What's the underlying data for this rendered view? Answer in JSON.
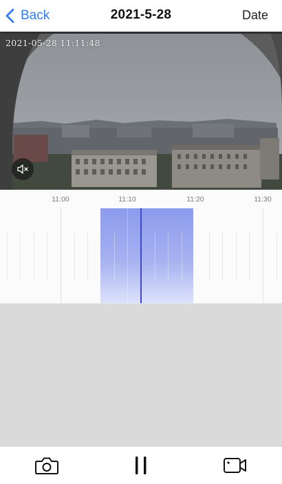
{
  "header": {
    "back_label": "Back",
    "title": "2021-5-28",
    "date_label": "Date"
  },
  "video": {
    "timestamp": "2021-05-28  11:11:48",
    "mute_icon": "speaker-muted-icon"
  },
  "timeline": {
    "ticks": [
      "11:00",
      "11:10",
      "11:20",
      "11:30"
    ],
    "recording_color": "#8c9bed",
    "cursor_color": "#3d48c8"
  },
  "toolbar": {
    "snapshot_icon": "camera-icon",
    "pause_icon": "pause-icon",
    "record_icon": "video-camera-icon"
  }
}
